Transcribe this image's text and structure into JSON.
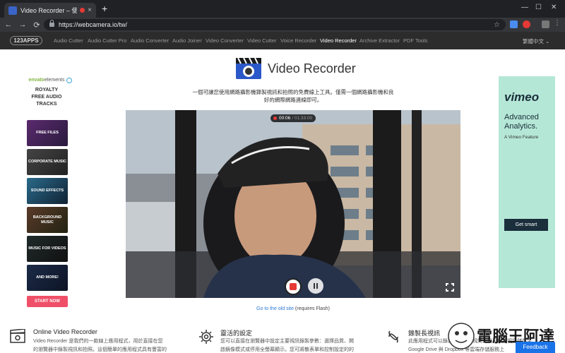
{
  "browser": {
    "tab_title": "Video Recorder – 使用網路",
    "url": "https://webcamera.io/tw/",
    "tab_close": "×",
    "new_tab": "+",
    "back": "←",
    "forward": "→",
    "reload": "⟳",
    "star": "☆",
    "win_min": "—",
    "win_max": "☐",
    "win_close": "✕"
  },
  "site_nav": {
    "logo": "123APPS",
    "items": [
      "Audio Cutter",
      "Audio Cutter Pro",
      "Audio Converter",
      "Audio Joiner",
      "Video Converter",
      "Video Cutter",
      "Voice Recorder",
      "Video Recorder",
      "Archive Extractor",
      "PDF Tools"
    ],
    "active": "Video Recorder",
    "language": "繁體中文 ⌄"
  },
  "left_ad": {
    "brand_prefix": "envato",
    "brand_suffix": "elements",
    "headline": [
      "ROYALTY",
      "FREE AUDIO",
      "TRACKS"
    ],
    "tiles": [
      "FREE FILES",
      "CORPORATE MUSIC",
      "SOUND EFFECTS",
      "BACKGROUND MUSIC",
      "MUSIC FOR VIDEOS",
      "AND MORE!"
    ],
    "cta": "START NOW"
  },
  "right_ad": {
    "brand": "vimeo",
    "headline_1": "Advanced",
    "headline_2": "Analytics.",
    "subline": "A Vimeo Feature",
    "cta": "Get smart"
  },
  "header": {
    "title": "Video Recorder",
    "description": "一個可讓您使用網路攝影機錄製視訊和拍照的免費線上工具。僅需一個網路攝影機和良好的網際網路連線即可。"
  },
  "recorder": {
    "elapsed": "00:06",
    "limit": "/ 01:33:00"
  },
  "old_site": {
    "link": "Go to the old site",
    "note": " (requires Flash)"
  },
  "features": [
    {
      "title": "Online Video Recorder",
      "desc": "Video Recorder 是我們的一款線上應用程式，用於直接在您的瀏覽器中錄製視訊和拍照。這個簡單的應用程式具有豐富的視訊和"
    },
    {
      "title": "靈活的設定",
      "desc": "您可以直接在瀏覽器中設定主要視訊錄製參數：選擇品質、開啟鏡像模式或停用全螢幕顯示。您可將散表單和控制設定的的效果"
    },
    {
      "title": "錄製長視訊",
      "desc": "此應用程式可以錄製長時間的視訊，且可以將視訊儲存至 Google Drive 與 Dropbox 等雲端存儲服務上"
    }
  ],
  "feedback": "Feedback",
  "watermark": "電腦王阿達"
}
